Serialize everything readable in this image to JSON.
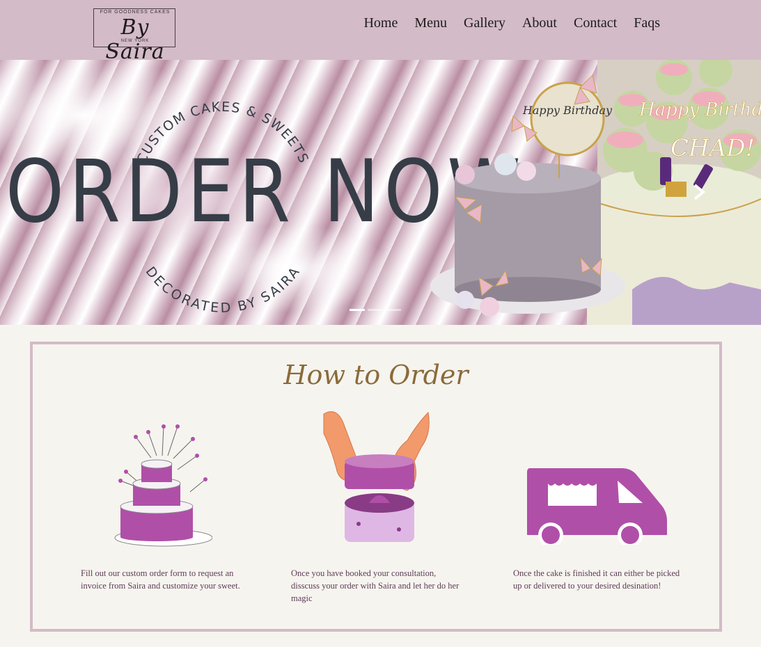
{
  "logo": {
    "tagline": "FOR GOODNESS CAKES",
    "name": "By Saira",
    "city": "NEW YORK"
  },
  "nav": {
    "items": [
      {
        "label": "Home"
      },
      {
        "label": "Menu"
      },
      {
        "label": "Gallery"
      },
      {
        "label": "About"
      },
      {
        "label": "Contact"
      },
      {
        "label": "Faqs"
      }
    ]
  },
  "hero": {
    "arc_top": "CUSTOM CAKES & SWEETS",
    "headline": "ORDER NOW",
    "arc_bottom": "DECORATED BY SAIRA",
    "topper_text": "Happy Birthday",
    "sign_text": "Happy Birthday CHAD!",
    "slide_count": 3,
    "active_slide": 1
  },
  "how_to_order": {
    "title": "How to Order",
    "steps": [
      {
        "icon": "tiered-cake-icon",
        "text": "Fill out our custom order form to request an invoice from Saira and customize your sweet."
      },
      {
        "icon": "cake-hands-icon",
        "text": "Once you have booked your consultation, disscuss your order with Saira and let her do her magic"
      },
      {
        "icon": "delivery-van-icon",
        "text": "Once the cake is finished it can either be picked up or delivered to your desired desination!"
      }
    ]
  },
  "colors": {
    "header_bg": "#d3bbc7",
    "page_bg": "#f6f4ef",
    "accent_purple": "#b04fa8",
    "headline": "#363d47",
    "title_gold": "#8a6b3a"
  }
}
